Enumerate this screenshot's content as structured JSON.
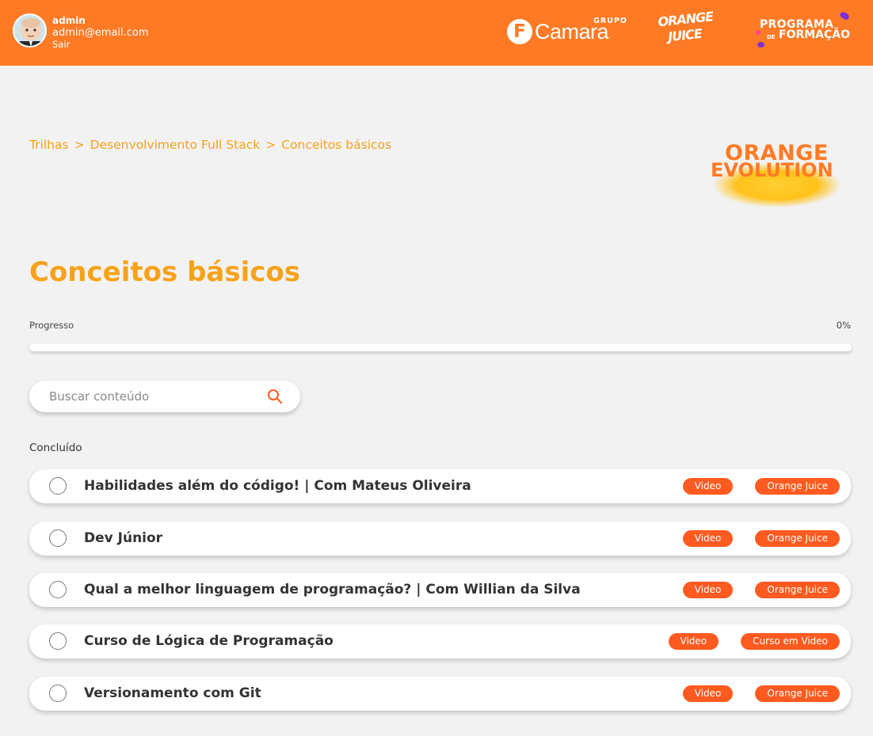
{
  "header": {
    "user_name": "admin",
    "user_email": "admin@email.com",
    "logout_label": "Sair",
    "logo_camara_grupo": "GRUPO",
    "logo_camara_name": "Camara",
    "logo_camara_letter": "F",
    "logo_oj_line1": "ORANGE",
    "logo_oj_line2": "JUICE",
    "logo_prog_line1": "PROGRAMA",
    "logo_prog_de": "DE",
    "logo_prog_line2": "FORMAÇÃO"
  },
  "breadcrumb": {
    "items": [
      "Trilhas",
      "Desenvolvimento Full Stack",
      "Conceitos básicos"
    ],
    "separator": ">"
  },
  "brand": {
    "line1": "ORANGE",
    "line2": "EVOLUTION"
  },
  "page": {
    "title": "Conceitos básicos"
  },
  "progress": {
    "label": "Progresso",
    "value_text": "0%",
    "fraction": 0
  },
  "search": {
    "placeholder": "Buscar conteúdo",
    "value": ""
  },
  "section": {
    "label": "Concluído"
  },
  "items": [
    {
      "title": "Habilidades além do código! | Com Mateus Oliveira",
      "tags": [
        "Video",
        "Orange Juice"
      ]
    },
    {
      "title": "Dev Júnior",
      "tags": [
        "Video",
        "Orange Juice"
      ]
    },
    {
      "title": "Qual a melhor linguagem de programação? | Com Willian da Silva",
      "tags": [
        "Video",
        "Orange Juice"
      ]
    },
    {
      "title": "Curso de Lógica de Programação",
      "tags": [
        "Video",
        "Curso em Video"
      ]
    },
    {
      "title": "Versionamento com Git",
      "tags": [
        "Video",
        "Orange Juice"
      ]
    }
  ],
  "colors": {
    "header_bg": "#ff7a25",
    "accent_text": "#f7a21b",
    "tag_bg": "#ff5a20"
  }
}
